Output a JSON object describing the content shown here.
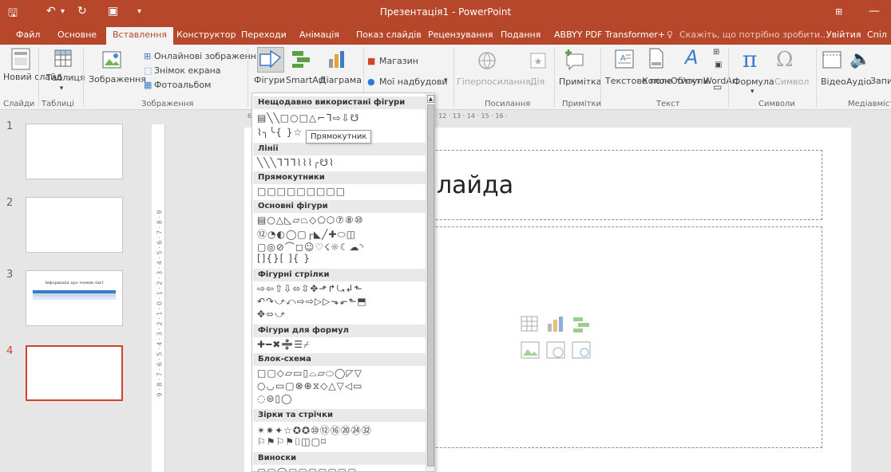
{
  "window": {
    "title": "Презентація1 - PowerPoint",
    "save_icon": "save-icon",
    "undo_icon": "undo-icon",
    "redo_icon": "redo-icon"
  },
  "tabs": [
    "Файл",
    "Основне",
    "Вставлення",
    "Конструктор",
    "Переходи",
    "Анімація",
    "Показ слайдів",
    "Рецензування",
    "Подання",
    "ABBYY PDF Transformer+"
  ],
  "tell_me": "Скажіть, що потрібно зробити...",
  "sign_in": "Увійти",
  "share": "Спіл",
  "ribbon": {
    "new_slide": "Новий слайд",
    "table": "Таблиця",
    "images": "Зображення",
    "online_images": "Онлайнові зображення",
    "screenshot": "Знімок екрана",
    "photo_album": "Фотоальбом",
    "shapes": "Фігури",
    "smartart": "SmartArt",
    "chart": "Діаграма",
    "store": "Магазин",
    "my_addins": "Мої надбудови",
    "hyperlink": "Гіперпосилання",
    "action": "Дія",
    "comment": "Примітка",
    "textbox": "Текстове поле",
    "header_footer": "Колон- титули",
    "wordart": "Об'єкт WordArt",
    "equation": "Формула",
    "symbol": "Символ",
    "video": "Відео",
    "audio": "Аудіо",
    "record": "Запи з е",
    "groups": {
      "slides": "Слайди",
      "tables": "Таблиці",
      "images": "Зображення",
      "links": "Посилання",
      "comments": "Примітки",
      "text": "Текст",
      "symbols": "Символи",
      "media": "Медіавміст"
    }
  },
  "dropdown": {
    "sections": [
      {
        "title": "Нещодавно використані фігури",
        "rows": [
          "▤╲╲□○□△⌐ᒣ⇨⇩☋",
          "⌇╮╰{ }☆"
        ]
      },
      {
        "title": "Лінії",
        "rows": [
          "╲╲╲ᒣᒣᒣ⌇⌇⌇╭☋⌇"
        ]
      },
      {
        "title": "Прямокутники",
        "rows": [
          "□□□□□□□□□"
        ]
      },
      {
        "title": "Основні фігури",
        "rows": [
          "▤○△◺▱⏢◇⬠⬡⑦⑧⑩",
          "⑫◔◐◯▢┌◣╱✚⬭◫",
          "▢◎⊘⌒◻☺♡☇☼☾☁◝",
          "[]{}[ ]{ }"
        ]
      },
      {
        "title": "Фігурні стрілки",
        "rows": [
          "⇨⇦⇧⇩⬄⇳✥⬏↱⤿↲⬑",
          "↶↷⤻⤺⇨⇨▷▷⬎⬐⬑⬒",
          "✥⬄⤻"
        ]
      },
      {
        "title": "Фігури для формул",
        "rows": [
          "✚━✖➗☰⌿"
        ]
      },
      {
        "title": "Блок-схема",
        "rows": [
          "□▢◇▱▭▯⌓▱⬭◯◸▽",
          "○◡▭▢⊗⊕⧖◇△▽◁▭",
          "◌⊜▯◯"
        ]
      },
      {
        "title": "Зірки та стрічки",
        "rows": [
          "✴✷✦☆✪✪⑩⑫⑯⑳㉔㉜",
          "⚐⚑⚐⚑⌷◫▢⌑"
        ]
      },
      {
        "title": "Виноски",
        "rows": [
          "▢▢◯▢▢▢▢▢▢▢"
        ]
      }
    ]
  },
  "tooltip": "Прямокутник",
  "slides": [
    {
      "number": "1"
    },
    {
      "number": "2"
    },
    {
      "number": "3",
      "caption": "Інформація про членів сім'ї"
    },
    {
      "number": "4"
    }
  ],
  "hruler": "6 · 5 · 4 · 3 · 2 · 1 · 0 · 1 · 2 · 3 · 4 · 5 · 6 · 7 · 8 · 9 · 10 · 11 · 12 · 13 · 14 · 15 · 16 ·",
  "vruler": "9 · 8 · 7 · 6 · 5 · 4 · 3 · 2 · 1 · 0 · 1 · 2 · 3 · 4 · 5 · 6 · 7 · 8 · 9",
  "slide": {
    "title_fragment": "лайда"
  },
  "colors": {
    "accent": "#b7472a",
    "selection": "#d0442c"
  }
}
